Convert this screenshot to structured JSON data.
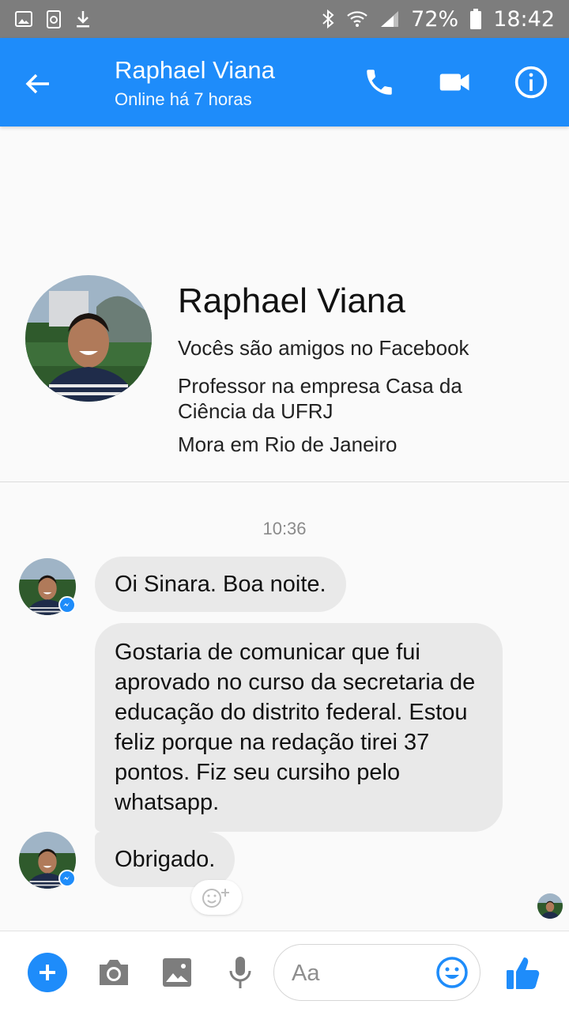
{
  "status_bar": {
    "battery": "72%",
    "time": "18:42",
    "icons": [
      "gallery-icon",
      "recycle-icon",
      "download-icon",
      "bluetooth-icon",
      "wifi-icon",
      "signal-icon",
      "battery-icon"
    ]
  },
  "header": {
    "name": "Raphael Viana",
    "status": "Online há 7 horas",
    "actions": [
      "phone-icon",
      "video-icon",
      "info-icon"
    ]
  },
  "profile": {
    "name": "Raphael Viana",
    "friends": "Vocês são amigos no Facebook",
    "work": "Professor na empresa Casa da Ciência da UFRJ",
    "location": "Mora em Rio de Janeiro"
  },
  "chat": {
    "timestamp": "10:36",
    "messages": [
      {
        "text": "Oi Sinara. Boa noite."
      },
      {
        "text": "Gostaria de comunicar que fui aprovado no curso da secretaria de educação do distrito federal. Estou feliz porque na redação tirei 37 pontos. Fiz seu cursiho pelo whatsapp."
      },
      {
        "text": "Obrigado."
      }
    ]
  },
  "composer": {
    "placeholder": "Aa"
  },
  "colors": {
    "accent": "#1e8cfa",
    "status_bar": "#7d7d7d",
    "bubble": "#e9e9e9"
  }
}
